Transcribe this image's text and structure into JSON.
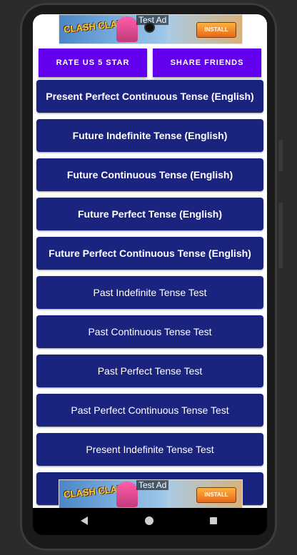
{
  "ads": {
    "top": {
      "label": "Test Ad",
      "logo": "CLASH CLANS",
      "install": "INSTALL"
    },
    "bottom": {
      "label": "Test Ad",
      "logo": "CLASH CLANS",
      "install": "INSTALL"
    }
  },
  "header_buttons": {
    "rate": "RATE US 5 STAR",
    "share": "SHARE FRIENDS"
  },
  "lessons": [
    {
      "label": "Present Perfect Continuous Tense (English)"
    },
    {
      "label": "Future Indefinite Tense (English)"
    },
    {
      "label": "Future Continuous Tense (English)"
    },
    {
      "label": "Future Perfect Tense (English)"
    },
    {
      "label": "Future Perfect Continuous Tense (English)"
    },
    {
      "label": "Past Indefinite Tense Test"
    },
    {
      "label": "Past Continuous Tense Test"
    },
    {
      "label": "Past Perfect Tense Test"
    },
    {
      "label": "Past Perfect Continuous Tense Test"
    },
    {
      "label": "Present Indefinite Tense Test"
    },
    {
      "label": ""
    }
  ],
  "colors": {
    "accent": "#6200ee",
    "list_item": "#1a237e",
    "text": "#ffffff"
  },
  "navbar": {
    "back": "back-icon",
    "home": "home-icon",
    "recents": "recents-icon"
  }
}
